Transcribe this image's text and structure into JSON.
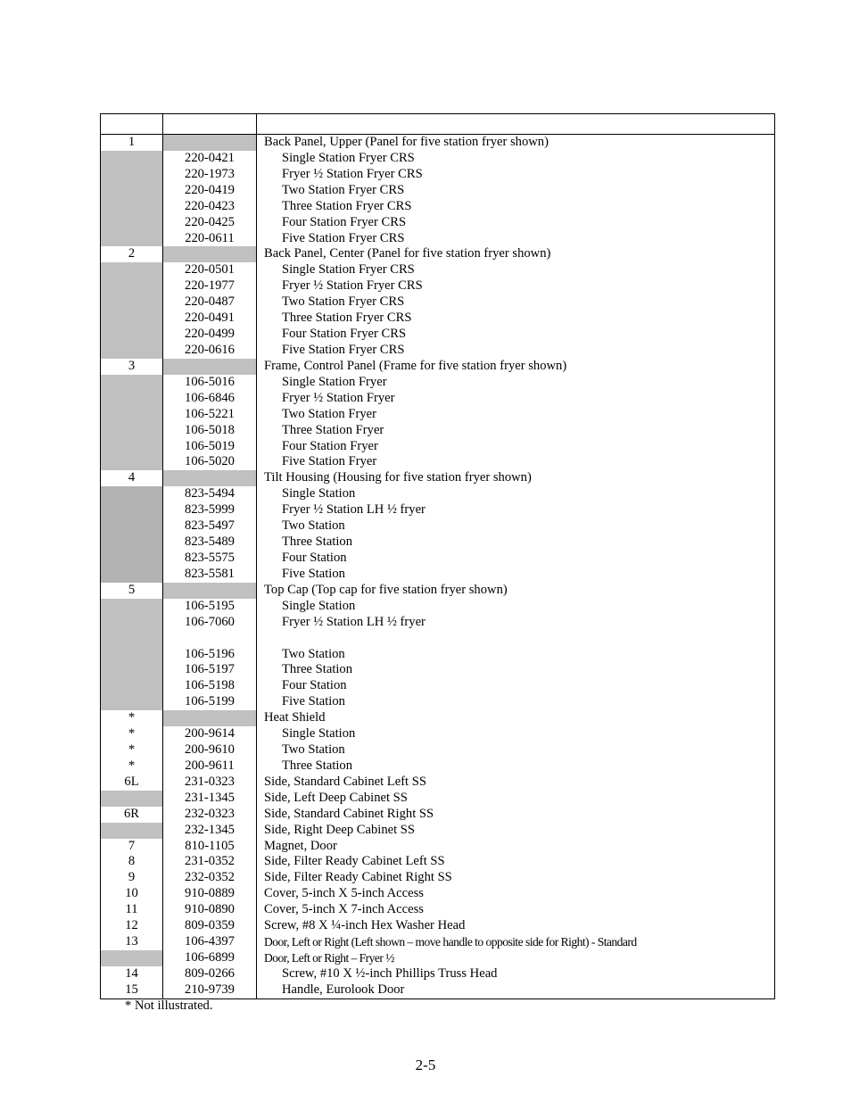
{
  "header": {
    "col1": "",
    "col2": "",
    "col3": ""
  },
  "rows": [
    {
      "item": "1",
      "part": "",
      "desc": "Back Panel, Upper (Panel for five station fryer shown)",
      "indent": false,
      "g1": false,
      "g2": true,
      "dark": false
    },
    {
      "item": "",
      "part": "220-0421",
      "desc": "Single Station Fryer CRS",
      "indent": true,
      "g1": true,
      "g2": false,
      "dark": false
    },
    {
      "item": "",
      "part": "220-1973",
      "desc": "Fryer ½ Station Fryer CRS",
      "indent": true,
      "g1": true,
      "g2": false,
      "dark": false
    },
    {
      "item": "",
      "part": "220-0419",
      "desc": "Two Station Fryer CRS",
      "indent": true,
      "g1": true,
      "g2": false,
      "dark": false
    },
    {
      "item": "",
      "part": "220-0423",
      "desc": "Three Station Fryer CRS",
      "indent": true,
      "g1": true,
      "g2": false,
      "dark": false
    },
    {
      "item": "",
      "part": "220-0425",
      "desc": "Four Station Fryer CRS",
      "indent": true,
      "g1": true,
      "g2": false,
      "dark": false
    },
    {
      "item": "",
      "part": "220-0611",
      "desc": "Five Station Fryer CRS",
      "indent": true,
      "g1": true,
      "g2": false,
      "dark": false
    },
    {
      "item": "2",
      "part": "",
      "desc": "Back Panel, Center (Panel for five station fryer shown)",
      "indent": false,
      "g1": false,
      "g2": true,
      "dark": false
    },
    {
      "item": "",
      "part": "220-0501",
      "desc": "Single Station Fryer CRS",
      "indent": true,
      "g1": true,
      "g2": false,
      "dark": false
    },
    {
      "item": "",
      "part": "220-1977",
      "desc": "Fryer ½ Station Fryer CRS",
      "indent": true,
      "g1": true,
      "g2": false,
      "dark": false
    },
    {
      "item": "",
      "part": "220-0487",
      "desc": "Two Station Fryer CRS",
      "indent": true,
      "g1": true,
      "g2": false,
      "dark": false
    },
    {
      "item": "",
      "part": "220-0491",
      "desc": "Three Station Fryer CRS",
      "indent": true,
      "g1": true,
      "g2": false,
      "dark": false
    },
    {
      "item": "",
      "part": "220-0499",
      "desc": "Four Station Fryer CRS",
      "indent": true,
      "g1": true,
      "g2": false,
      "dark": false
    },
    {
      "item": "",
      "part": "220-0616",
      "desc": "Five Station Fryer CRS",
      "indent": true,
      "g1": true,
      "g2": false,
      "dark": false
    },
    {
      "item": "3",
      "part": "",
      "desc": "Frame, Control Panel (Frame for five station fryer shown)",
      "indent": false,
      "g1": false,
      "g2": true,
      "dark": false
    },
    {
      "item": "",
      "part": "106-5016",
      "desc": "Single Station Fryer",
      "indent": true,
      "g1": true,
      "g2": false,
      "dark": false
    },
    {
      "item": "",
      "part": "106-6846",
      "desc": "Fryer ½ Station Fryer",
      "indent": true,
      "g1": true,
      "g2": false,
      "dark": false
    },
    {
      "item": "",
      "part": "106-5221",
      "desc": "Two Station Fryer",
      "indent": true,
      "g1": true,
      "g2": false,
      "dark": false
    },
    {
      "item": "",
      "part": "106-5018",
      "desc": "Three Station Fryer",
      "indent": true,
      "g1": true,
      "g2": false,
      "dark": false
    },
    {
      "item": "",
      "part": "106-5019",
      "desc": "Four Station Fryer",
      "indent": true,
      "g1": true,
      "g2": false,
      "dark": false
    },
    {
      "item": "",
      "part": "106-5020",
      "desc": "Five Station Fryer",
      "indent": true,
      "g1": true,
      "g2": false,
      "dark": false
    },
    {
      "item": "4",
      "part": "",
      "desc": "Tilt Housing (Housing for five station fryer shown)",
      "indent": false,
      "g1": false,
      "g2": true,
      "dark": false
    },
    {
      "item": "",
      "part": "823-5494",
      "desc": "Single Station",
      "indent": true,
      "g1": true,
      "g2": false,
      "dark": true
    },
    {
      "item": "",
      "part": "823-5999",
      "desc": "Fryer ½ Station LH ½ fryer",
      "indent": true,
      "g1": true,
      "g2": false,
      "dark": true
    },
    {
      "item": "",
      "part": "823-5497",
      "desc": "Two Station",
      "indent": true,
      "g1": true,
      "g2": false,
      "dark": true
    },
    {
      "item": "",
      "part": "823-5489",
      "desc": "Three Station",
      "indent": true,
      "g1": true,
      "g2": false,
      "dark": true
    },
    {
      "item": "",
      "part": "823-5575",
      "desc": "Four Station",
      "indent": true,
      "g1": true,
      "g2": false,
      "dark": true
    },
    {
      "item": "",
      "part": "823-5581",
      "desc": "Five Station",
      "indent": true,
      "g1": true,
      "g2": false,
      "dark": true
    },
    {
      "item": "5",
      "part": "",
      "desc": "Top Cap (Top cap for five station fryer shown)",
      "indent": false,
      "g1": false,
      "g2": true,
      "dark": false
    },
    {
      "item": "",
      "part": "106-5195",
      "desc": "Single Station",
      "indent": true,
      "g1": true,
      "g2": false,
      "dark": false
    },
    {
      "item": "",
      "part": "106-7060",
      "desc": "Fryer ½ Station LH ½ fryer",
      "indent": true,
      "g1": true,
      "g2": false,
      "dark": false
    },
    {
      "item": "",
      "part": "",
      "desc": "",
      "indent": true,
      "g1": true,
      "g2": false,
      "dark": false
    },
    {
      "item": "",
      "part": "106-5196",
      "desc": "Two Station",
      "indent": true,
      "g1": true,
      "g2": false,
      "dark": false
    },
    {
      "item": "",
      "part": "106-5197",
      "desc": "Three Station",
      "indent": true,
      "g1": true,
      "g2": false,
      "dark": false
    },
    {
      "item": "",
      "part": "106-5198",
      "desc": "Four Station",
      "indent": true,
      "g1": true,
      "g2": false,
      "dark": false
    },
    {
      "item": "",
      "part": "106-5199",
      "desc": "Five Station",
      "indent": true,
      "g1": true,
      "g2": false,
      "dark": false
    },
    {
      "item": "*",
      "part": "",
      "desc": "Heat Shield",
      "indent": false,
      "g1": false,
      "g2": true,
      "dark": false
    },
    {
      "item": "*",
      "part": "200-9614",
      "desc": "Single Station",
      "indent": true,
      "g1": false,
      "g2": false,
      "dark": false
    },
    {
      "item": "*",
      "part": "200-9610",
      "desc": "Two Station",
      "indent": true,
      "g1": false,
      "g2": false,
      "dark": false
    },
    {
      "item": "*",
      "part": "200-9611",
      "desc": "Three Station",
      "indent": true,
      "g1": false,
      "g2": false,
      "dark": false
    },
    {
      "item": "6L",
      "part": "231-0323",
      "desc": "Side, Standard Cabinet Left SS",
      "indent": false,
      "g1": false,
      "g2": false,
      "dark": false
    },
    {
      "item": "",
      "part": "231-1345",
      "desc": "Side, Left Deep Cabinet SS",
      "indent": false,
      "g1": true,
      "g2": false,
      "dark": false
    },
    {
      "item": "6R",
      "part": "232-0323",
      "desc": "Side, Standard Cabinet Right SS",
      "indent": false,
      "g1": false,
      "g2": false,
      "dark": false
    },
    {
      "item": "",
      "part": "232-1345",
      "desc": "Side, Right Deep Cabinet SS",
      "indent": false,
      "g1": true,
      "g2": false,
      "dark": false
    },
    {
      "item": "7",
      "part": "810-1105",
      "desc": "Magnet, Door",
      "indent": false,
      "g1": false,
      "g2": false,
      "dark": false
    },
    {
      "item": "8",
      "part": "231-0352",
      "desc": "Side, Filter Ready Cabinet Left SS",
      "indent": false,
      "g1": false,
      "g2": false,
      "dark": false
    },
    {
      "item": "9",
      "part": "232-0352",
      "desc": "Side, Filter Ready Cabinet Right SS",
      "indent": false,
      "g1": false,
      "g2": false,
      "dark": false
    },
    {
      "item": "10",
      "part": "910-0889",
      "desc": "Cover, 5-inch X 5-inch Access",
      "indent": false,
      "g1": false,
      "g2": false,
      "dark": false
    },
    {
      "item": "11",
      "part": "910-0890",
      "desc": "Cover, 5-inch X 7-inch Access",
      "indent": false,
      "g1": false,
      "g2": false,
      "dark": false
    },
    {
      "item": "12",
      "part": "809-0359",
      "desc": "Screw, #8 X ¼-inch Hex Washer Head",
      "indent": false,
      "g1": false,
      "g2": false,
      "dark": false
    },
    {
      "item": "13",
      "part": "106-4397",
      "desc": "Door, Left or Right (Left shown – move handle to opposite side for Right) - Standard",
      "indent": false,
      "g1": false,
      "g2": false,
      "dark": false,
      "cond": true
    },
    {
      "item": "",
      "part": "106-6899",
      "desc": "Door, Left or Right – Fryer ½",
      "indent": false,
      "g1": true,
      "g2": false,
      "dark": false,
      "cond": true
    },
    {
      "item": "14",
      "part": "809-0266",
      "desc": "Screw, #10 X ½-inch Phillips Truss Head",
      "indent": true,
      "g1": false,
      "g2": false,
      "dark": false
    },
    {
      "item": "15",
      "part": "210-9739",
      "desc": "Handle, Eurolook Door",
      "indent": true,
      "g1": false,
      "g2": false,
      "dark": false
    }
  ],
  "footnote": "* Not illustrated.",
  "page_number": "2-5",
  "colors": {
    "shade": "#c0c0c0",
    "shade_dark": "#b2b2b2"
  }
}
